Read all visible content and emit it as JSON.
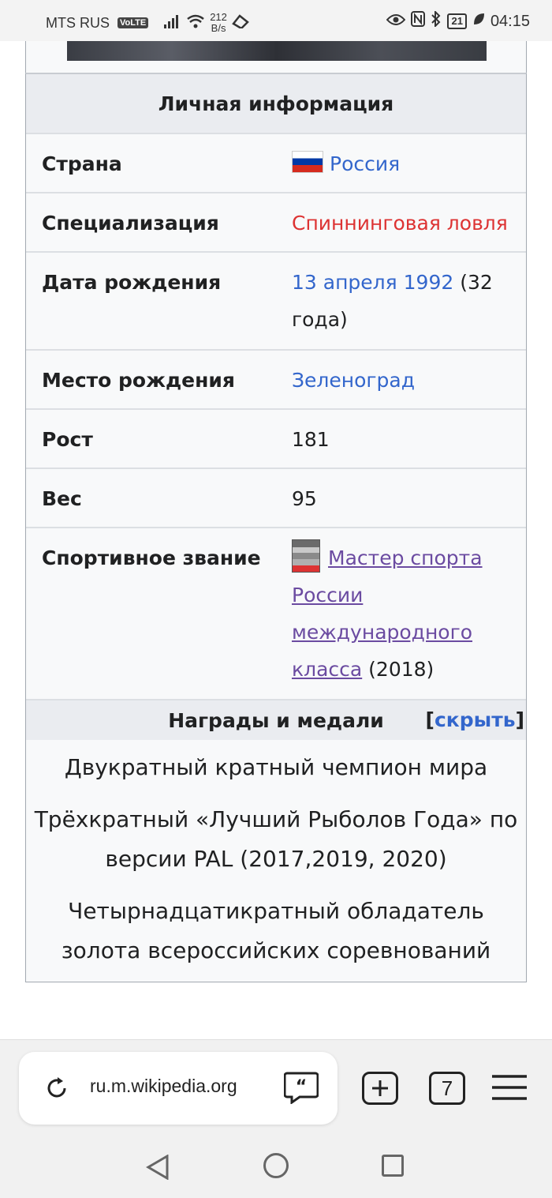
{
  "status_bar": {
    "carrier": "MTS RUS",
    "volte": "VoLTE",
    "net_speed_value": "212",
    "net_speed_unit": "B/s",
    "battery": "21",
    "time": "04:15"
  },
  "infobox": {
    "section_title": "Личная информация",
    "rows": [
      {
        "label": "Страна",
        "value": "Россия"
      },
      {
        "label": "Специализация",
        "value": "Спиннинговая ловля"
      },
      {
        "label": "Дата рождения",
        "value_link": "13 апреля 1992",
        "value_rest": " (32 года)"
      },
      {
        "label": "Место рождения",
        "value": "Зеленоград"
      },
      {
        "label": "Рост",
        "value": "181"
      },
      {
        "label": "Вес",
        "value": "95"
      },
      {
        "label": "Спортивное звание",
        "value_link": "Мастер спорта России международного класса",
        "value_rest": " (2018)"
      }
    ],
    "awards": {
      "title": "Награды и медали",
      "toggle_open": "[",
      "toggle_label": "скрыть",
      "toggle_close": "]",
      "items": [
        "Двукратный кратный чемпион мира",
        "Трёхкратный «Лучший Рыболов Года» по версии PAL (2017,2019, 2020)",
        "Четырнадцатикратный обладатель золота всероссийских соревнований"
      ]
    }
  },
  "browser": {
    "url": "ru.m.wikipedia.org",
    "tab_count": "7"
  }
}
